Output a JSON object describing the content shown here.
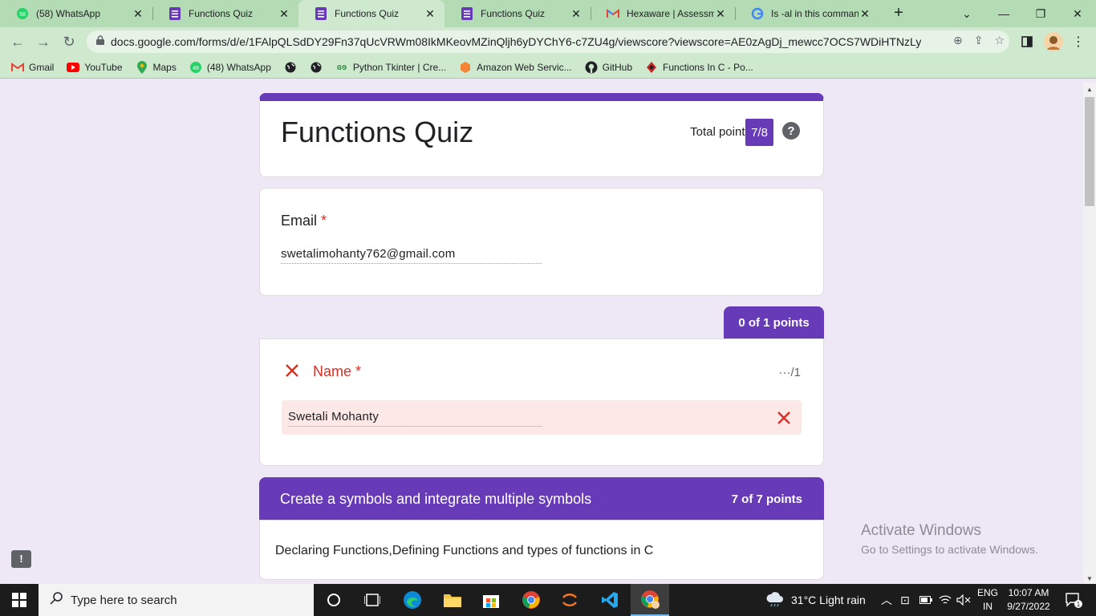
{
  "browser": {
    "tabs": [
      {
        "label": "(58) WhatsApp",
        "icon": "whatsapp-icon",
        "badge": "58"
      },
      {
        "label": "Functions Quiz",
        "icon": "forms-icon"
      },
      {
        "label": "Functions Quiz",
        "icon": "forms-icon",
        "active": true
      },
      {
        "label": "Functions Quiz",
        "icon": "forms-icon"
      },
      {
        "label": "Hexaware | Assessmer",
        "icon": "gmail-icon"
      },
      {
        "label": "Is -al in this comman",
        "icon": "google-icon"
      }
    ],
    "url": "docs.google.com/forms/d/e/1FAlpQLSdDY29Fn37qUcVRWm08IkMKeovMZinQljh6yDYChY6-c7ZU4g/viewscore?viewscore=AE0zAgDj_mewcc7OCS7WDiHTNzLyTJv...",
    "bookmarks": [
      {
        "label": "Gmail",
        "icon": "gmail-icon"
      },
      {
        "label": "YouTube",
        "icon": "youtube-icon"
      },
      {
        "label": "Maps",
        "icon": "maps-icon"
      },
      {
        "label": "(48) WhatsApp",
        "icon": "whatsapp-icon",
        "badge": "48"
      },
      {
        "label": "",
        "icon": "globe-icon"
      },
      {
        "label": "",
        "icon": "globe-icon"
      },
      {
        "label": "Python Tkinter | Cre...",
        "icon": "gfg-icon"
      },
      {
        "label": "Amazon Web Servic...",
        "icon": "aws-icon"
      },
      {
        "label": "GitHub",
        "icon": "github-icon"
      },
      {
        "label": "Functions In C - Po...",
        "icon": "diamond-icon"
      }
    ]
  },
  "form": {
    "title": "Functions Quiz",
    "total_points_label": "Total points",
    "total_score": "7/8",
    "help": "?",
    "email": {
      "label": "Email",
      "required": "*",
      "value": "swetalimohanty762@gmail.com"
    },
    "name_question": {
      "points_tab": "0 of 1 points",
      "label": "Name",
      "required": "*",
      "points": "···/1",
      "value": "Swetali Mohanty"
    },
    "section": {
      "title": "Create a symbols and integrate multiple symbols",
      "points": "7 of 7 points",
      "description": "Declaring Functions,Defining Functions and types of functions in C"
    },
    "feedback": "!"
  },
  "watermark": {
    "line1": "Activate Windows",
    "line2": "Go to Settings to activate Windows."
  },
  "taskbar": {
    "search_placeholder": "Type here to search",
    "weather": "31°C  Light rain",
    "lang_top": "ENG",
    "lang_bottom": "IN",
    "time": "10:07 AM",
    "date": "9/27/2022",
    "notification_count": "1"
  },
  "colors": {
    "accent": "#673ab7",
    "error": "#d93025",
    "tabstrip": "#b4dcb4",
    "toolbar": "#cfe9cf",
    "page_bg": "#ede7f6"
  }
}
